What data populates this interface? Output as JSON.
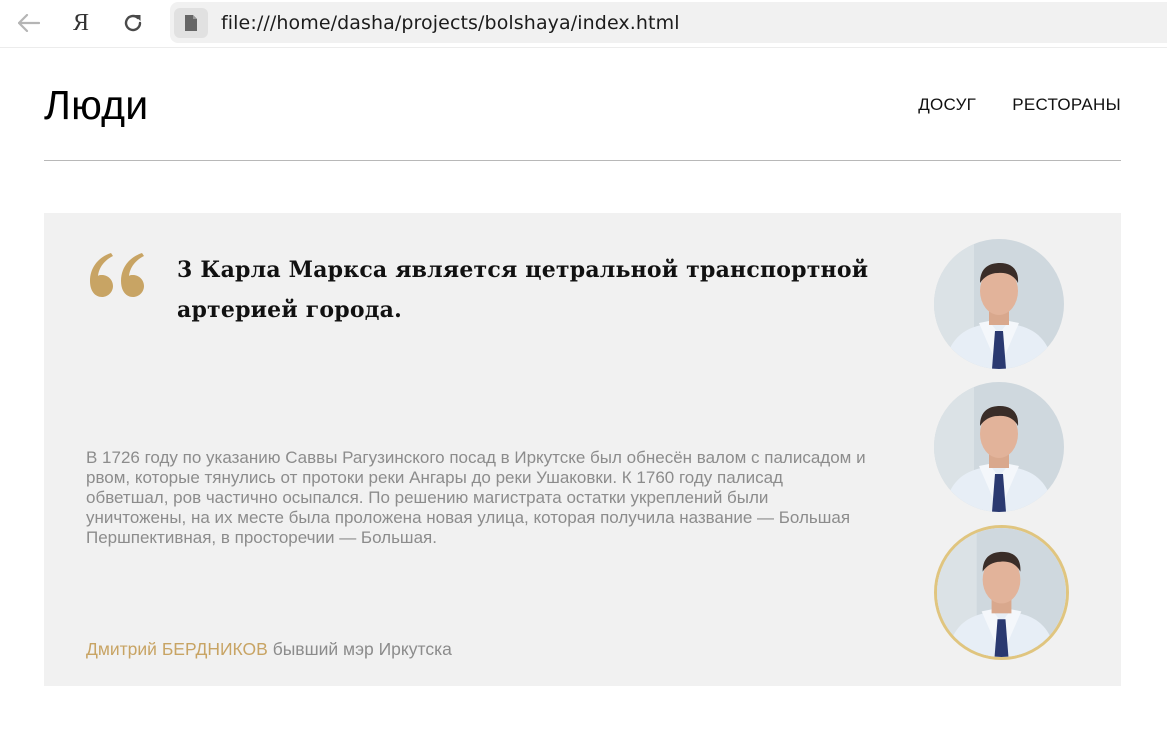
{
  "browser": {
    "url": "file:///home/dasha/projects/bolshaya/index.html",
    "ya_label": "Я"
  },
  "header": {
    "title": "Люди",
    "nav": [
      "ДОСУГ",
      "РЕСТОРАНЫ"
    ]
  },
  "quote": {
    "title": "3 Карла Маркса является цетральной транспортной артерией города.",
    "body": "В 1726 году по указанию Саввы Рагузинского посад в Иркутске был обнесён валом с палисадом и рвом, которые тянулись от протоки реки Ангары до реки Ушаковки. К 1760 году палисад обветшал, ров частично осыпался. По решению магистрата остатки укреплений были уничтожены, на их месте была проложена новая улица, которая получила название — Большая Першпективная, в просторечии — Большая.",
    "author_name": "Дмитрий БЕРДНИКОВ",
    "author_role": "бывший мэр Иркутска"
  },
  "avatars": [
    "portrait-photo",
    "portrait-photo",
    "portrait-photo"
  ],
  "colors": {
    "accent_gold": "#c8a464",
    "active_ring": "#e0c57f",
    "card_bg": "#f1f1f1",
    "muted_text": "#8c8c8c"
  }
}
